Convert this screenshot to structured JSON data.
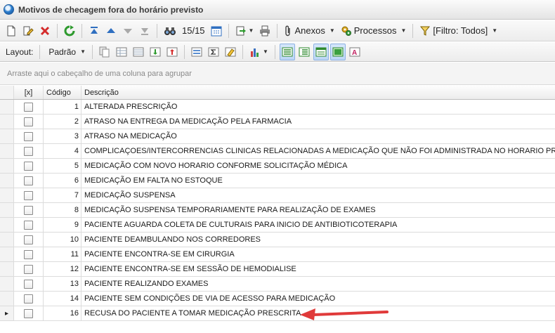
{
  "window": {
    "title": "Motivos de checagem fora do horário previsto"
  },
  "toolbar": {
    "record_counter": "15/15",
    "anexos_label": "Anexos",
    "processos_label": "Processos",
    "filter_label": "[Filtro: Todos]"
  },
  "toolbar2": {
    "layout_label": "Layout:",
    "padrao_label": "Padrão"
  },
  "group_panel": {
    "hint": "Arraste aqui o cabeçalho de uma coluna para agrupar"
  },
  "grid": {
    "headers": {
      "check": "[x]",
      "code": "Código",
      "desc": "Descrição"
    },
    "rows": [
      {
        "code": "1",
        "desc": "ALTERADA PRESCRIÇÃO"
      },
      {
        "code": "2",
        "desc": "ATRASO NA ENTREGA DA MEDICAÇÃO PELA FARMACIA"
      },
      {
        "code": "3",
        "desc": "ATRASO NA MEDICAÇÃO"
      },
      {
        "code": "4",
        "desc": "COMPLICAÇOES/INTERCORRENCIAS CLINICAS RELACIONADAS A MEDICAÇÃO QUE NÃO FOI ADMINISTRADA NO HORARIO PROGRAMADO"
      },
      {
        "code": "5",
        "desc": "MEDICAÇÃO COM NOVO HORARIO  CONFORME SOLICITAÇÃO MÉDICA"
      },
      {
        "code": "6",
        "desc": "MEDICAÇÃO EM FALTA NO ESTOQUE"
      },
      {
        "code": "7",
        "desc": "MEDICAÇÃO SUSPENSA"
      },
      {
        "code": "8",
        "desc": "MEDICAÇÃO SUSPENSA TEMPORARIAMENTE PARA REALIZAÇÃO DE EXAMES"
      },
      {
        "code": "9",
        "desc": "PACIENTE AGUARDA COLETA DE CULTURAIS PARA INICIO DE ANTIBIOTICOTERAPIA"
      },
      {
        "code": "10",
        "desc": "PACIENTE DEAMBULANDO NOS CORREDORES"
      },
      {
        "code": "11",
        "desc": "PACIENTE ENCONTRA-SE EM CIRURGIA"
      },
      {
        "code": "12",
        "desc": "PACIENTE ENCONTRA-SE EM SESSÃO DE HEMODIALISE"
      },
      {
        "code": "13",
        "desc": "PACIENTE REALIZANDO EXAMES"
      },
      {
        "code": "14",
        "desc": "PACIENTE SEM CONDIÇÕES DE VIA DE ACESSO PARA MEDICAÇÃO"
      },
      {
        "code": "16",
        "desc": "RECUSA DO PACIENTE A TOMAR MEDICAÇÃO PRESCRITA"
      }
    ]
  },
  "colors": {
    "accent": "#2c7fd0",
    "arrow": "#e03a3a",
    "delete": "#d42b2b",
    "refresh": "#2e9a2e"
  }
}
